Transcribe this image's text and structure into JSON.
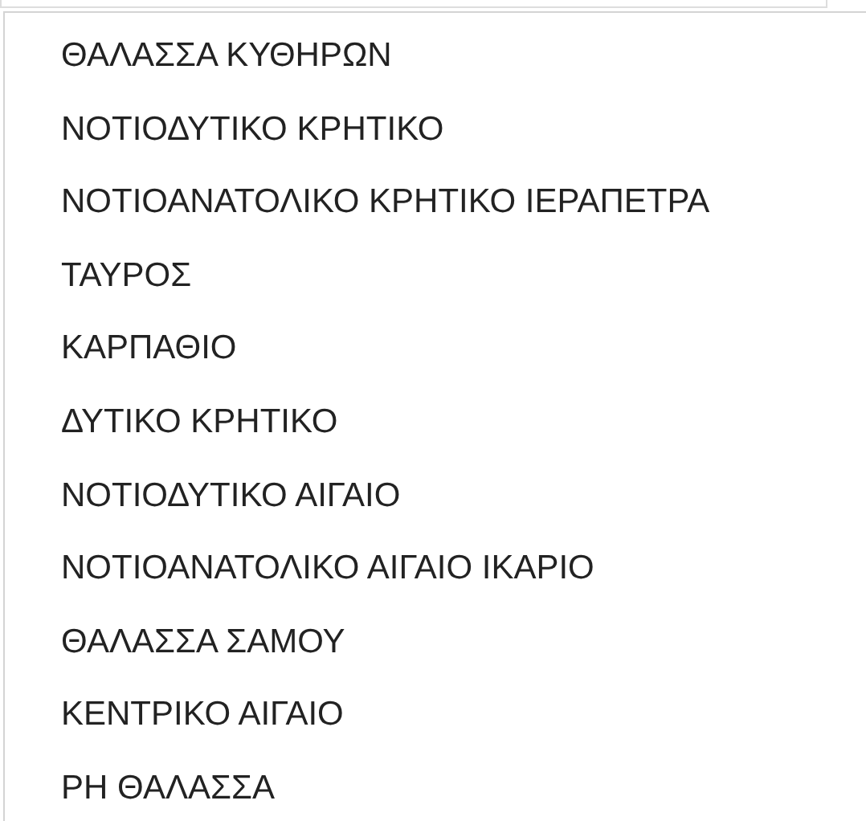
{
  "dropdown": {
    "items": [
      {
        "label": "ΘΑΛΑΣΣΑ ΚΥΘΗΡΩΝ"
      },
      {
        "label": "ΝΟΤΙΟΔΥΤΙΚΟ ΚΡΗΤΙΚΟ"
      },
      {
        "label": "ΝΟΤΙΟΑΝΑΤΟΛΙΚΟ ΚΡΗΤΙΚΟ ΙΕΡΑΠΕΤΡΑ"
      },
      {
        "label": "ΤΑΥΡΟΣ"
      },
      {
        "label": "ΚΑΡΠΑΘΙΟ"
      },
      {
        "label": "ΔΥΤΙΚΟ ΚΡΗΤΙΚΟ"
      },
      {
        "label": "ΝΟΤΙΟΔΥΤΙΚΟ ΑΙΓΑΙΟ"
      },
      {
        "label": "ΝΟΤΙΟΑΝΑΤΟΛΙΚΟ ΑΙΓΑΙΟ ΙΚΑΡΙΟ"
      },
      {
        "label": "ΘΑΛΑΣΣΑ ΣΑΜΟΥ"
      },
      {
        "label": "ΚΕΝΤΡΙΚΟ ΑΙΓΑΙΟ"
      },
      {
        "label": "ΡΗ ΘΑΛΑΣΣΑ"
      }
    ]
  }
}
